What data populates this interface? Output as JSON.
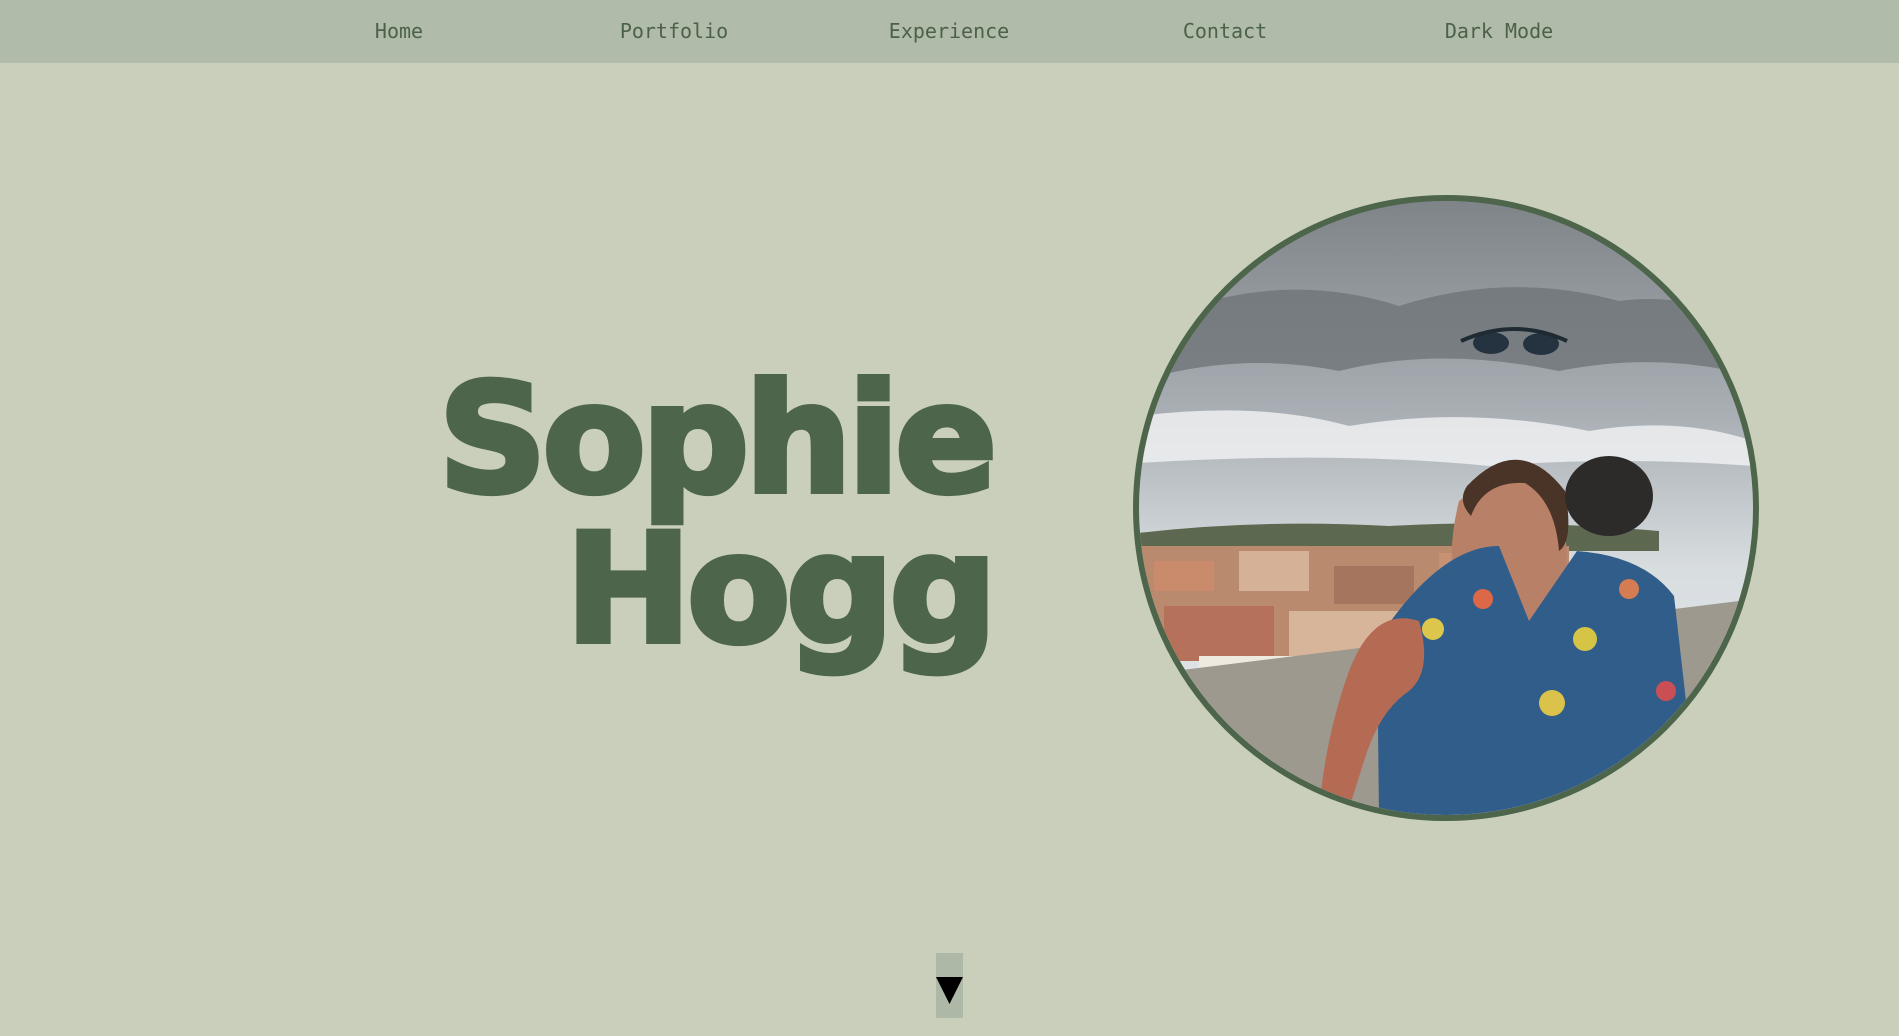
{
  "nav": {
    "home": "Home",
    "portfolio": "Portfolio",
    "experience": "Experience",
    "contact": "Contact",
    "dark_mode": "Dark Mode"
  },
  "hero": {
    "first_name": "Sophie",
    "last_name": "Hogg",
    "photo": "profile-photo"
  },
  "scroll_icon": "triangle-down-icon",
  "colors": {
    "background": "#cacfbb",
    "nav_background": "#b0bba9",
    "accent_green": "#4d654a",
    "nav_text": "#4c6149"
  }
}
